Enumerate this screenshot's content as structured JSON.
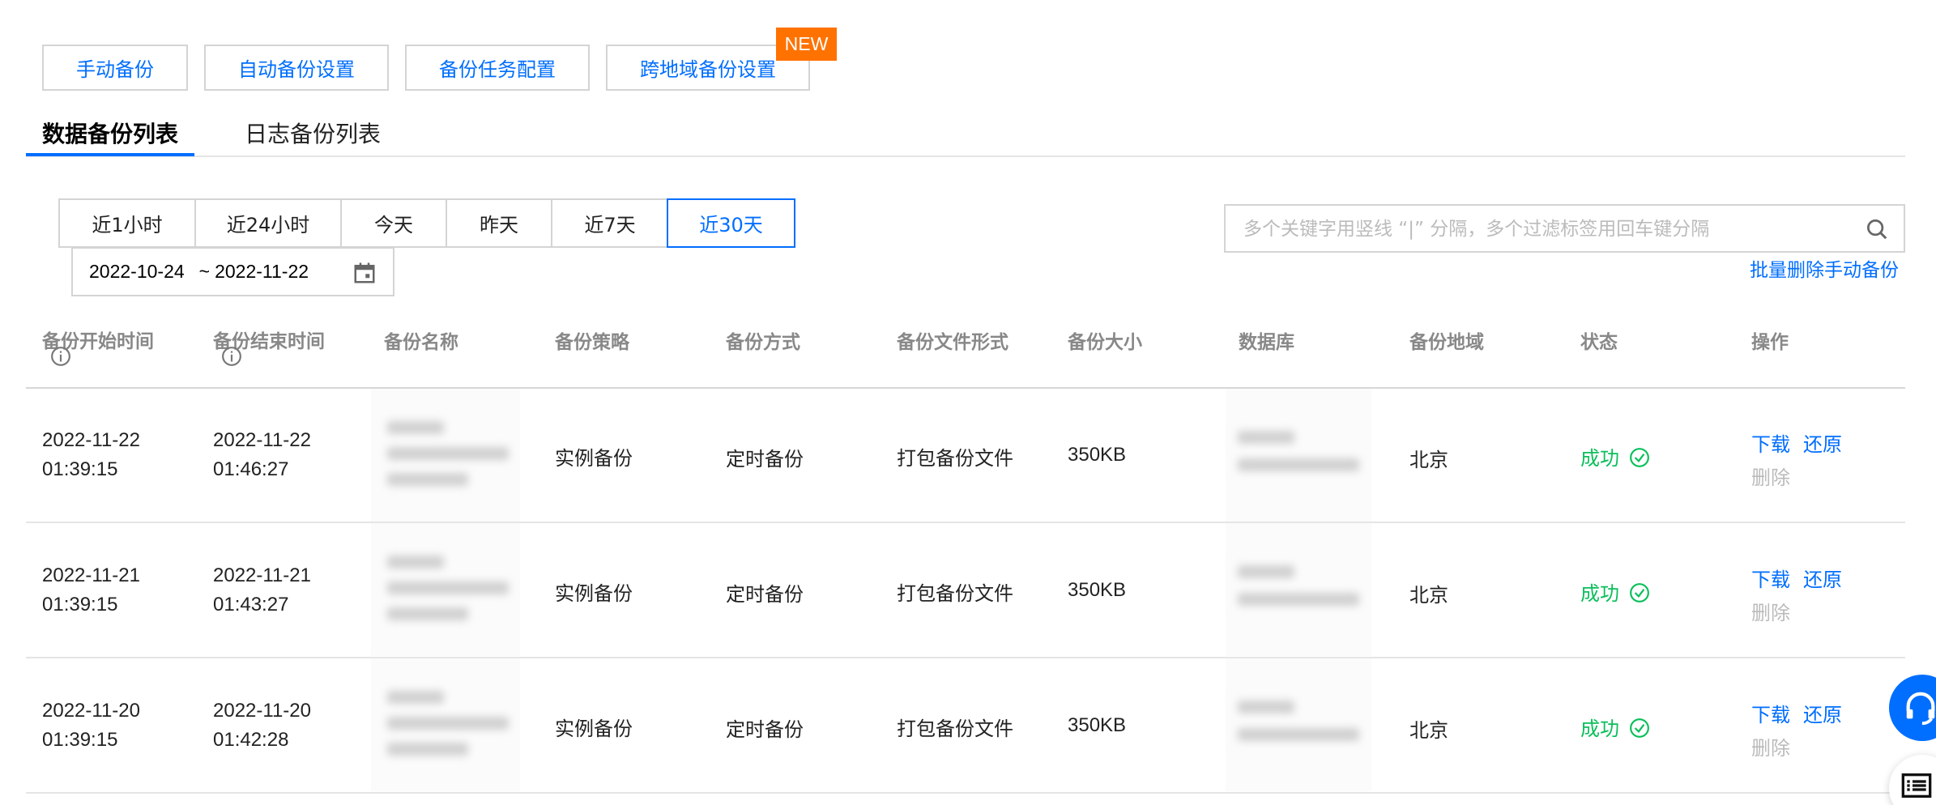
{
  "toolbar": {
    "manual_backup": "手动备份",
    "auto_backup_settings": "自动备份设置",
    "backup_task_config": "备份任务配置",
    "cross_region_backup": "跨地域备份设置",
    "new_badge": "NEW"
  },
  "tabs": [
    {
      "label": "数据备份列表",
      "active": true
    },
    {
      "label": "日志备份列表",
      "active": false
    }
  ],
  "time_ranges": [
    {
      "label": "近1小时"
    },
    {
      "label": "近24小时"
    },
    {
      "label": "今天"
    },
    {
      "label": "昨天"
    },
    {
      "label": "近7天"
    },
    {
      "label": "近30天",
      "active": true
    }
  ],
  "date_range": {
    "start": "2022-10-24",
    "separator": "~",
    "end": "2022-11-22"
  },
  "search": {
    "placeholder": "多个关键字用竖线 “|” 分隔，多个过滤标签用回车键分隔",
    "value": ""
  },
  "bulk_delete": "批量删除手动备份",
  "table": {
    "headers": {
      "start_time": "备份开始时间",
      "end_time": "备份结束时间",
      "name": "备份名称",
      "policy": "备份策略",
      "method": "备份方式",
      "file_format": "备份文件形式",
      "size": "备份大小",
      "database": "数据库",
      "region": "备份地域",
      "status": "状态",
      "actions": "操作"
    },
    "rows": [
      {
        "start_date": "2022-11-22",
        "start_time": "01:39:15",
        "end_date": "2022-11-22",
        "end_time": "01:46:27",
        "policy": "实例备份",
        "method": "定时备份",
        "file_format": "打包备份文件",
        "size": "350KB",
        "region": "北京",
        "status": "成功"
      },
      {
        "start_date": "2022-11-21",
        "start_time": "01:39:15",
        "end_date": "2022-11-21",
        "end_time": "01:43:27",
        "policy": "实例备份",
        "method": "定时备份",
        "file_format": "打包备份文件",
        "size": "350KB",
        "region": "北京",
        "status": "成功"
      },
      {
        "start_date": "2022-11-20",
        "start_time": "01:39:15",
        "end_date": "2022-11-20",
        "end_time": "01:42:28",
        "policy": "实例备份",
        "method": "定时备份",
        "file_format": "打包备份文件",
        "size": "350KB",
        "region": "北京",
        "status": "成功"
      }
    ],
    "actions": {
      "download": "下载",
      "restore": "还原",
      "delete": "删除"
    }
  },
  "colors": {
    "accent": "#006eff",
    "success": "#0abf5b",
    "badge": "#ff7200"
  },
  "icons": {
    "search": "search-icon",
    "calendar": "calendar-icon",
    "info": "info-icon",
    "success": "check-circle-icon",
    "support": "headset-icon",
    "list": "list-icon"
  }
}
